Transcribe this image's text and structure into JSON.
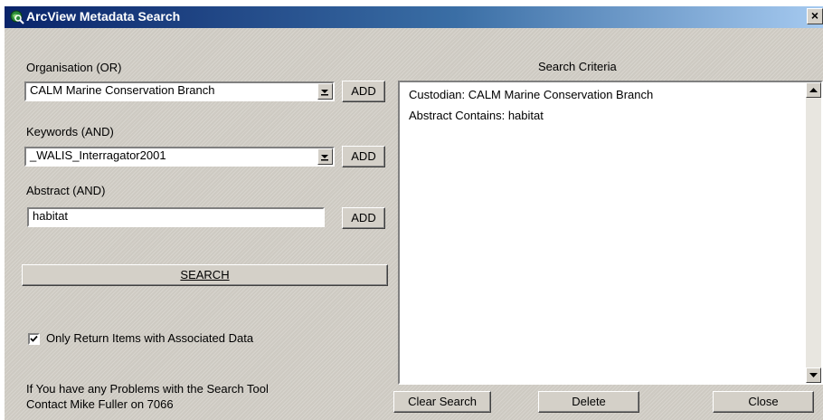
{
  "window": {
    "title": "ArcView Metadata Search",
    "close_glyph": "×",
    "icon": "globe-search-icon"
  },
  "organisation": {
    "label": "Organisation (OR)",
    "selected": "CALM Marine Conservation Branch",
    "add_label": "ADD"
  },
  "keywords": {
    "label": "Keywords (AND)",
    "selected": "_WALIS_Interragator2001",
    "add_label": "ADD"
  },
  "abstract": {
    "label": "Abstract (AND)",
    "value": "habitat",
    "add_label": "ADD"
  },
  "search_button": "SEARCH",
  "only_return": {
    "label": "Only Return Items with Associated Data",
    "checked": true
  },
  "help_text": {
    "line1": "If You have any Problems with the Search Tool",
    "line2": "Contact Mike Fuller on 7066"
  },
  "criteria": {
    "title": "Search Criteria",
    "items": [
      "Custodian: CALM Marine Conservation Branch",
      "Abstract Contains: habitat"
    ]
  },
  "buttons": {
    "clear_search": "Clear Search",
    "delete": "Delete",
    "close": "Close"
  }
}
